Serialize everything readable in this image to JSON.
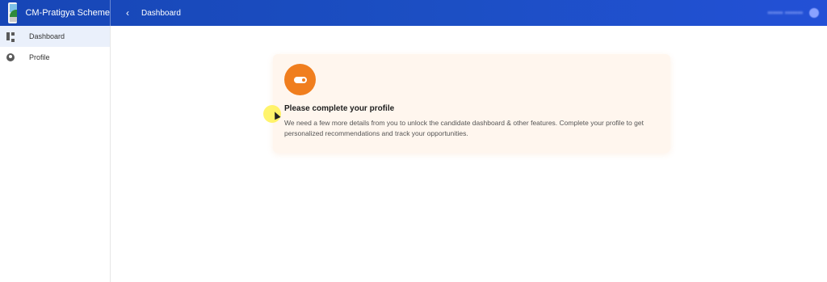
{
  "app": {
    "title": "CM-Pratigya Scheme"
  },
  "header": {
    "breadcrumb": "Dashboard",
    "back_icon": "chevron-left-icon"
  },
  "sidebar": {
    "items": [
      {
        "label": "Dashboard",
        "icon": "dashboard-icon",
        "active": true
      },
      {
        "label": "Profile",
        "icon": "account-circle-icon",
        "active": false
      }
    ]
  },
  "main": {
    "alert": {
      "icon": "toggle-icon",
      "title": "Please complete your profile",
      "message": "We need a few more details from you to unlock the candidate dashboard & other features. Complete your profile to get personalized recommendations and track your opportunities."
    }
  },
  "colors": {
    "header": "#1c4fc4",
    "accent_orange": "#f07e1e",
    "card_bg": "#fff6ee",
    "sidebar_active": "#eaf0fb"
  }
}
